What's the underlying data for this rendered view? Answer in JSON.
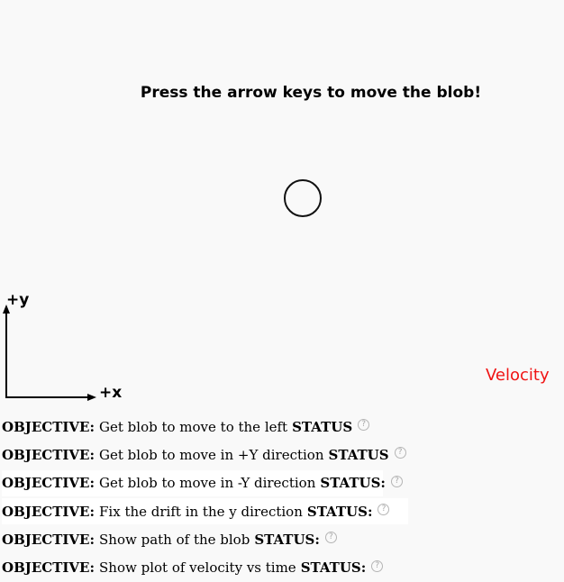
{
  "instruction": "Press the arrow keys to move the blob!",
  "axes": {
    "y_label": "+y",
    "x_label": "+x"
  },
  "velocity_label": "Velocity",
  "colors": {
    "background": "#f9f9f9",
    "velocity_text": "#f01414",
    "help_icon": "#b5b5b5"
  },
  "objectives": [
    {
      "prefix": "OBJECTIVE:",
      "text": "Get blob to move to the left",
      "status_label": "STATUS",
      "status_icon": "help-circle-icon",
      "icon_glyph": "?"
    },
    {
      "prefix": "OBJECTIVE:",
      "text": "Get blob to move in +Y direction",
      "status_label": "STATUS",
      "status_icon": "help-circle-icon",
      "icon_glyph": "?"
    },
    {
      "prefix": "OBJECTIVE:",
      "text": "Get blob to move in -Y direction",
      "status_label": "STATUS:",
      "status_icon": "help-circle-icon",
      "icon_glyph": "?"
    },
    {
      "prefix": "OBJECTIVE:",
      "text": "Fix the drift in the y direction",
      "status_label": "STATUS:",
      "status_icon": "help-circle-icon",
      "icon_glyph": "?"
    },
    {
      "prefix": "OBJECTIVE:",
      "text": "Show path of the blob",
      "status_label": "STATUS:",
      "status_icon": "help-circle-icon",
      "icon_glyph": "?"
    },
    {
      "prefix": "OBJECTIVE:",
      "text": "Show plot of velocity vs time",
      "status_label": "STATUS:",
      "status_icon": "help-circle-icon",
      "icon_glyph": "?"
    }
  ]
}
